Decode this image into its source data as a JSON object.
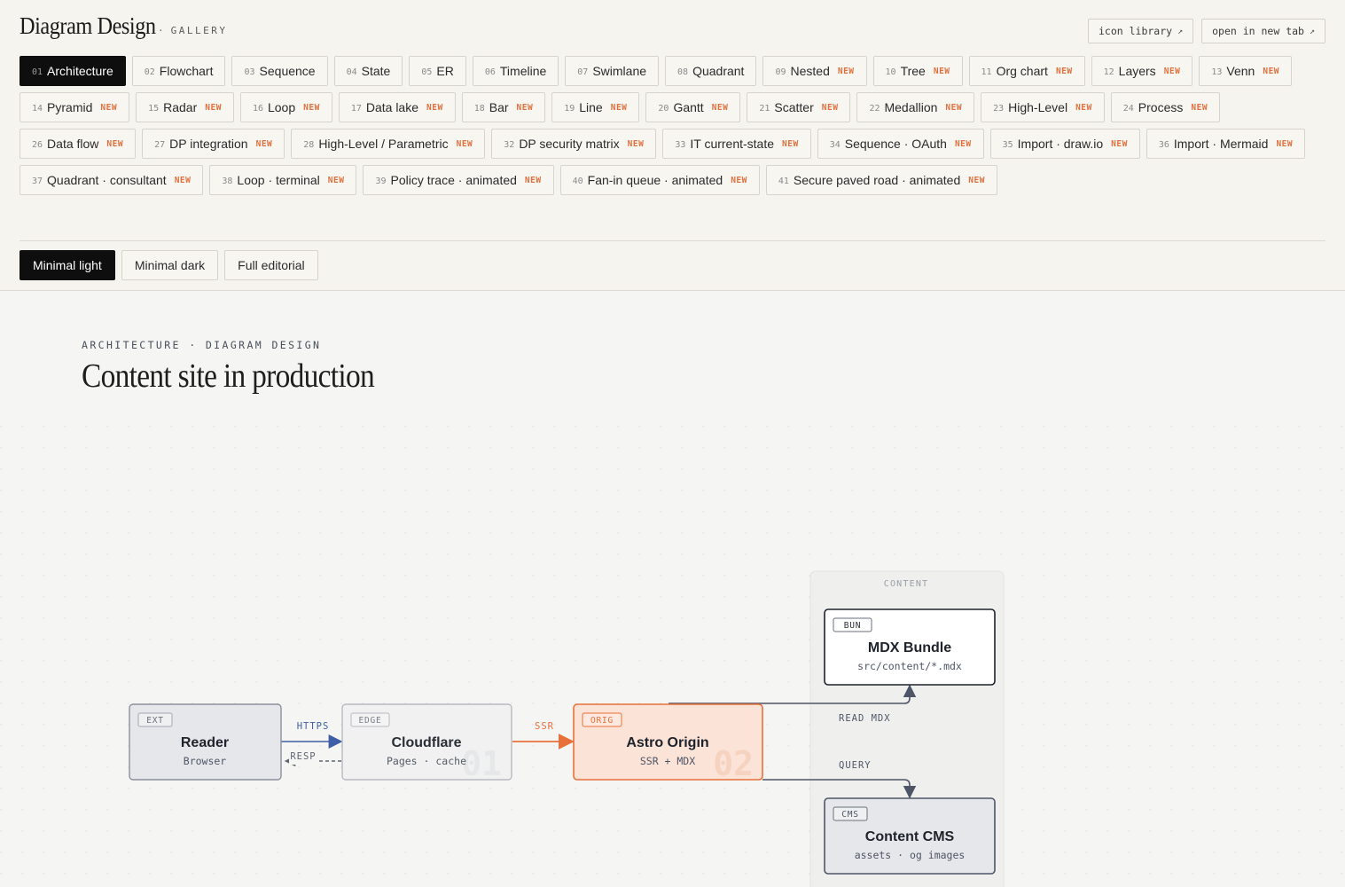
{
  "brand": {
    "title": "Diagram Design",
    "separator": "·",
    "section": "GALLERY"
  },
  "top_actions": [
    {
      "label": "icon library",
      "icon": "arrow-up-right-icon",
      "glyph": "↗"
    },
    {
      "label": "open in new tab",
      "icon": "arrow-up-right-icon",
      "glyph": "↗"
    }
  ],
  "tabs": [
    {
      "num": "01",
      "label": "Architecture",
      "new": "",
      "active": true
    },
    {
      "num": "02",
      "label": "Flowchart",
      "new": ""
    },
    {
      "num": "03",
      "label": "Sequence",
      "new": ""
    },
    {
      "num": "04",
      "label": "State",
      "new": ""
    },
    {
      "num": "05",
      "label": "ER",
      "new": ""
    },
    {
      "num": "06",
      "label": "Timeline",
      "new": ""
    },
    {
      "num": "07",
      "label": "Swimlane",
      "new": ""
    },
    {
      "num": "08",
      "label": "Quadrant",
      "new": ""
    },
    {
      "num": "09",
      "label": "Nested",
      "new": "NEW"
    },
    {
      "num": "10",
      "label": "Tree",
      "new": "NEW"
    },
    {
      "num": "11",
      "label": "Org chart",
      "new": "NEW"
    },
    {
      "num": "12",
      "label": "Layers",
      "new": "NEW"
    },
    {
      "num": "13",
      "label": "Venn",
      "new": "NEW"
    },
    {
      "num": "14",
      "label": "Pyramid",
      "new": "NEW"
    },
    {
      "num": "15",
      "label": "Radar",
      "new": "NEW"
    },
    {
      "num": "16",
      "label": "Loop",
      "new": "NEW"
    },
    {
      "num": "17",
      "label": "Data lake",
      "new": "NEW"
    },
    {
      "num": "18",
      "label": "Bar",
      "new": "NEW"
    },
    {
      "num": "19",
      "label": "Line",
      "new": "NEW"
    },
    {
      "num": "20",
      "label": "Gantt",
      "new": "NEW"
    },
    {
      "num": "21",
      "label": "Scatter",
      "new": "NEW"
    },
    {
      "num": "22",
      "label": "Medallion",
      "new": "NEW"
    },
    {
      "num": "23",
      "label": "High-Level",
      "new": "NEW"
    },
    {
      "num": "24",
      "label": "Process",
      "new": "NEW"
    },
    {
      "num": "26",
      "label": "Data flow",
      "new": "NEW"
    },
    {
      "num": "27",
      "label": "DP integration",
      "new": "NEW"
    },
    {
      "num": "28",
      "label": "High-Level / Parametric",
      "new": "NEW"
    },
    {
      "num": "32",
      "label": "DP security matrix",
      "new": "NEW"
    },
    {
      "num": "33",
      "label": "IT current-state",
      "new": "NEW"
    },
    {
      "num": "34",
      "label": "Sequence · OAuth",
      "new": "NEW"
    },
    {
      "num": "35",
      "label": "Import · draw.io",
      "new": "NEW"
    },
    {
      "num": "36",
      "label": "Import · Mermaid",
      "new": "NEW"
    },
    {
      "num": "37",
      "label": "Quadrant · consultant",
      "new": "NEW"
    },
    {
      "num": "38",
      "label": "Loop · terminal",
      "new": "NEW"
    },
    {
      "num": "39",
      "label": "Policy trace · animated",
      "new": "NEW"
    },
    {
      "num": "40",
      "label": "Fan-in queue · animated",
      "new": "NEW"
    },
    {
      "num": "41",
      "label": "Secure paved road · animated",
      "new": "NEW"
    }
  ],
  "themes": [
    {
      "label": "Minimal light",
      "active": true
    },
    {
      "label": "Minimal dark"
    },
    {
      "label": "Full editorial"
    }
  ],
  "canvas": {
    "eyebrow": "ARCHITECTURE · DIAGRAM DESIGN",
    "title": "Content site in production"
  },
  "diagram": {
    "group_label": "CONTENT",
    "nodes": {
      "reader": {
        "tag": "EXT",
        "title": "Reader",
        "subtitle": "Browser"
      },
      "cloudflare": {
        "tag": "EDGE",
        "title": "Cloudflare",
        "subtitle": "Pages · cache",
        "index": "01"
      },
      "astro": {
        "tag": "ORIG",
        "title": "Astro Origin",
        "subtitle": "SSR + MDX",
        "index": "02"
      },
      "mdx": {
        "tag": "BUN",
        "title": "MDX Bundle",
        "subtitle": "src/content/*.mdx"
      },
      "cms": {
        "tag": "CMS",
        "title": "Content CMS",
        "subtitle": "assets · og images"
      }
    },
    "edges": {
      "https": "HTTPS",
      "resp": "RESP",
      "ssr": "SSR",
      "read_mdx": "READ MDX",
      "query": "QUERY"
    },
    "colors": {
      "accent": "#e8703a",
      "link": "#3e5fa6",
      "muted": "#5f6473",
      "border": "#8a909c"
    }
  }
}
